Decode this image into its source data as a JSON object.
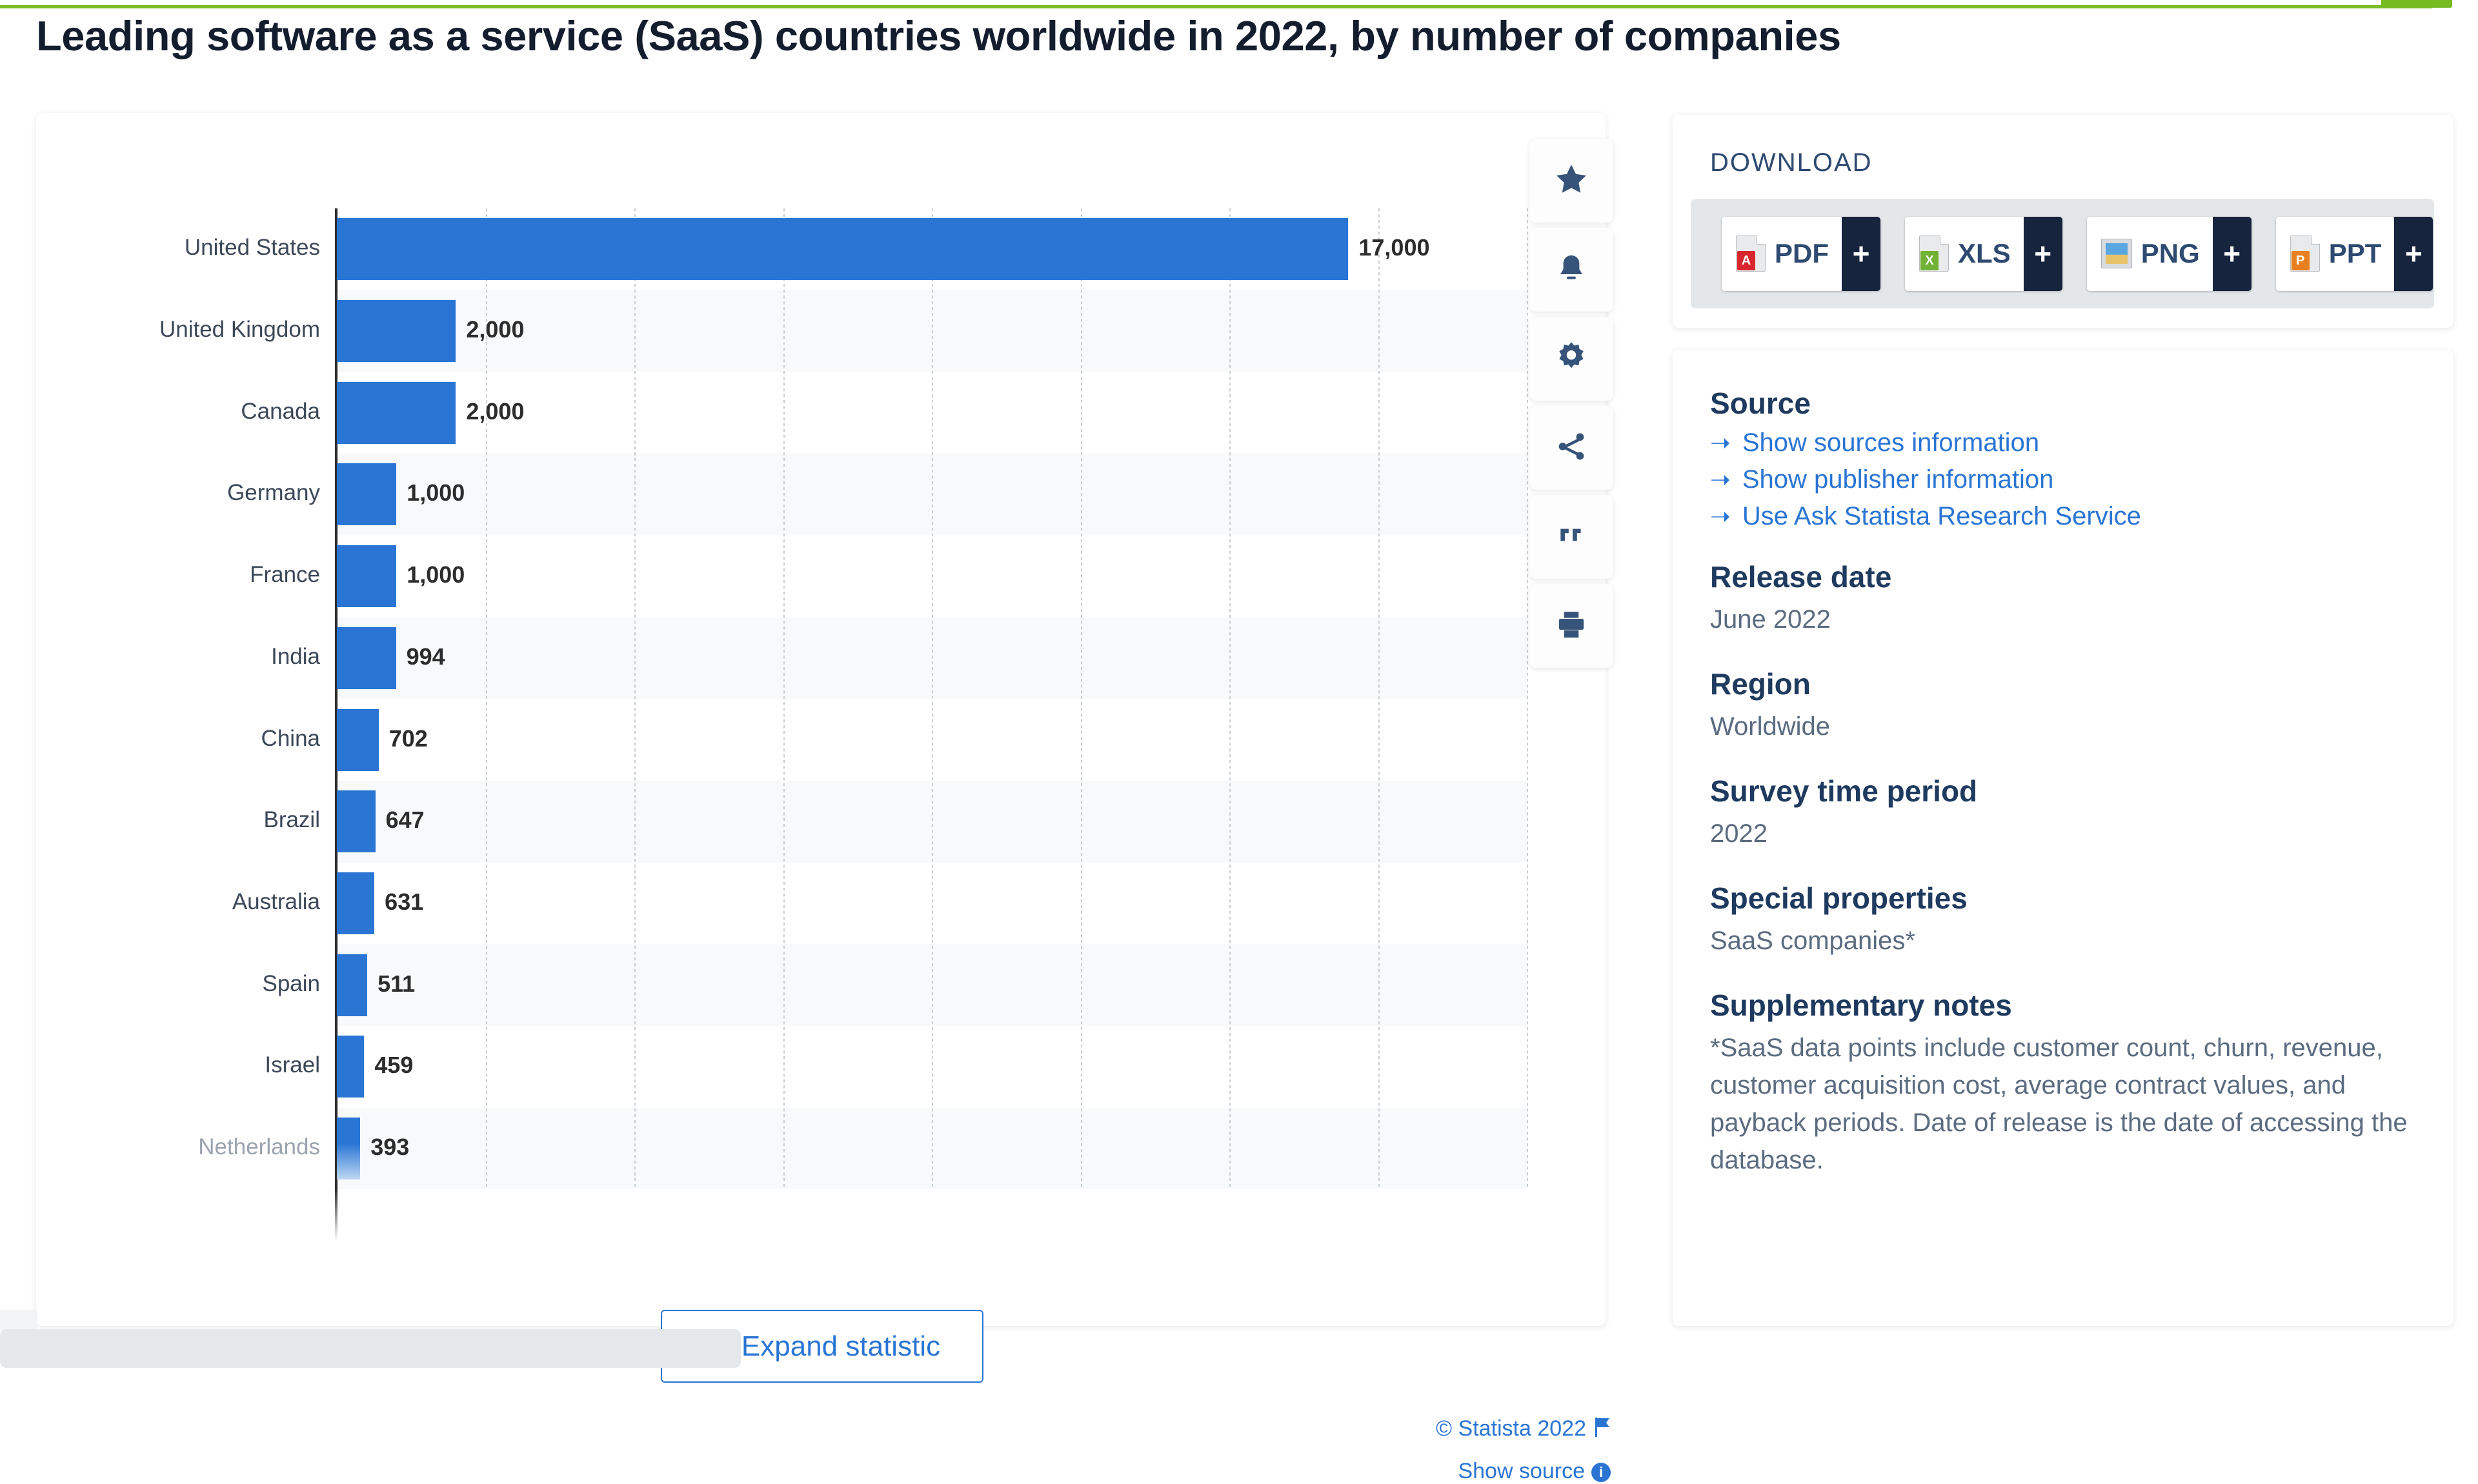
{
  "page_title": "Leading software as a service (SaaS) countries worldwide in 2022, by number of companies",
  "colors": {
    "bar": "#2a75d4",
    "link": "#2a75d4",
    "heading": "#1f3a5f",
    "brand_green": "#76bc21",
    "download_plus": "#16243e"
  },
  "chart_data": {
    "type": "bar",
    "orientation": "horizontal",
    "title": "Leading software as a service (SaaS) countries worldwide in 2022, by number of companies",
    "xlabel": "",
    "ylabel": "",
    "xlim": [
      0,
      20000
    ],
    "grid": true,
    "gridline_values": [
      2500,
      5000,
      7500,
      10000,
      12500,
      15000,
      17500,
      20000
    ],
    "categories": [
      "United States",
      "United Kingdom",
      "Canada",
      "Germany",
      "France",
      "India",
      "China",
      "Brazil",
      "Australia",
      "Spain",
      "Israel",
      "Netherlands"
    ],
    "values": [
      17000,
      2000,
      2000,
      1000,
      1000,
      994,
      702,
      647,
      631,
      511,
      459,
      393
    ],
    "value_labels": [
      "17,000",
      "2,000",
      "2,000",
      "1,000",
      "1,000",
      "994",
      "702",
      "647",
      "631",
      "511",
      "459",
      "393"
    ],
    "legend": []
  },
  "chart_card": {
    "expand_button": "Expand statistic",
    "expand_icon": "plus-circle-icon",
    "credit": "© Statista 2022",
    "flag_icon": "flag-icon",
    "show_source": "Show source",
    "info_icon": "info-icon"
  },
  "icon_rail": [
    {
      "name": "favorite-star-icon",
      "glyph": "star"
    },
    {
      "name": "notification-bell-icon",
      "glyph": "bell"
    },
    {
      "name": "settings-gear-icon",
      "glyph": "gear"
    },
    {
      "name": "share-icon",
      "glyph": "share"
    },
    {
      "name": "citation-quote-icon",
      "glyph": "quote"
    },
    {
      "name": "print-icon",
      "glyph": "print"
    }
  ],
  "download": {
    "heading": "DOWNLOAD",
    "plus_label": "+",
    "buttons": [
      {
        "label": "PDF",
        "icon": "pdf-file-icon",
        "badge_color": "#d8262c",
        "badge_text": "A"
      },
      {
        "label": "XLS",
        "icon": "xls-file-icon",
        "badge_color": "#71b236",
        "badge_text": "X"
      },
      {
        "label": "PNG",
        "icon": "png-image-icon",
        "badge_color": "#5aa6e0",
        "badge_text": ""
      },
      {
        "label": "PPT",
        "icon": "ppt-file-icon",
        "badge_color": "#e8801f",
        "badge_text": "P"
      }
    ]
  },
  "meta": {
    "source_heading": "Source",
    "source_links": [
      "Show sources information",
      "Show publisher information",
      "Use Ask Statista Research Service"
    ],
    "release_date_heading": "Release date",
    "release_date_value": "June 2022",
    "region_heading": "Region",
    "region_value": "Worldwide",
    "survey_heading": "Survey time period",
    "survey_value": "2022",
    "special_heading": "Special properties",
    "special_value": "SaaS companies*",
    "notes_heading": "Supplementary notes",
    "notes_value": "*SaaS data points include customer count, churn, revenue, customer acquisition cost, average contract values, and payback periods. Date of release is the date of accessing the database."
  }
}
